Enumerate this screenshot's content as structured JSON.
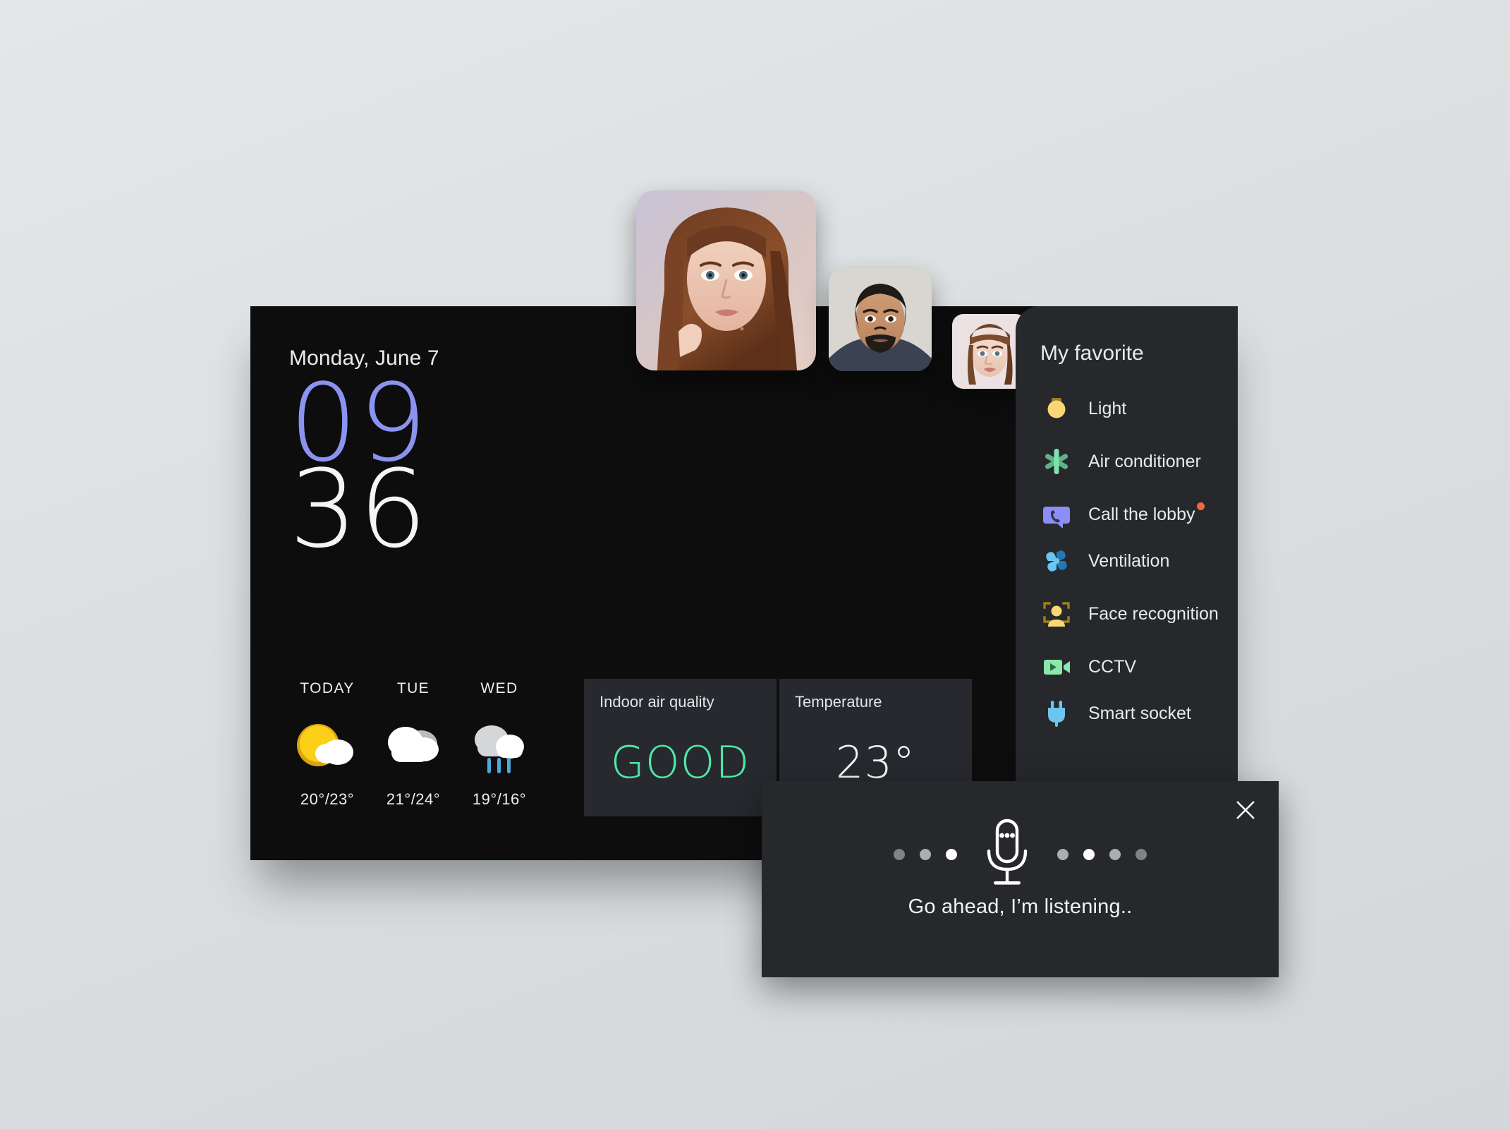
{
  "clock": {
    "date": "Monday, June 7",
    "hours": "09",
    "minutes": "36"
  },
  "people": [
    {
      "name": "person-photo-large",
      "alt": "woman with long auburn hair"
    },
    {
      "name": "person-photo-medium",
      "alt": "man with beard"
    },
    {
      "name": "person-photo-small",
      "alt": "woman with bangs"
    }
  ],
  "forecast": {
    "days": [
      {
        "label": "TODAY",
        "icon": "sun-behind-cloud-icon",
        "temp": "20°/23°"
      },
      {
        "label": "TUE",
        "icon": "cloud-icon",
        "temp": "21°/24°"
      },
      {
        "label": "WED",
        "icon": "rain-cloud-icon",
        "temp": "19°/16°"
      }
    ]
  },
  "stats": [
    {
      "title": "Indoor air quality",
      "value": "GOOD",
      "tone": "good"
    },
    {
      "title": "Temperature",
      "value": "23°",
      "tone": "temp"
    }
  ],
  "voice": {
    "caption": "Go ahead, I’m listening..",
    "close_label": "×",
    "mic_icon": "microphone-icon",
    "dots_left": [
      0.42,
      0.62,
      1.0
    ],
    "dots_right": [
      0.62,
      1.0,
      0.62,
      0.42
    ]
  },
  "sidebar": {
    "title": "My favorite",
    "items": [
      {
        "label": "Light",
        "icon": "ceiling-light-icon",
        "badge": false
      },
      {
        "label": "Air conditioner",
        "icon": "air-conditioner-icon",
        "badge": false
      },
      {
        "label": "Call the lobby",
        "icon": "phone-call-icon",
        "badge": true
      },
      {
        "label": "Ventilation",
        "icon": "fan-icon",
        "badge": false
      },
      {
        "label": "Face recognition",
        "icon": "face-recognition-icon",
        "badge": false
      },
      {
        "label": "CCTV",
        "icon": "video-camera-icon",
        "badge": false
      },
      {
        "label": "Smart socket",
        "icon": "power-plug-icon",
        "badge": false
      }
    ]
  },
  "colors": {
    "panel_bg": "#0d0d0e",
    "card_bg": "#26282c",
    "hours": "#8b93f0",
    "good": "#4ee8a8",
    "badge": "#f2683c"
  }
}
